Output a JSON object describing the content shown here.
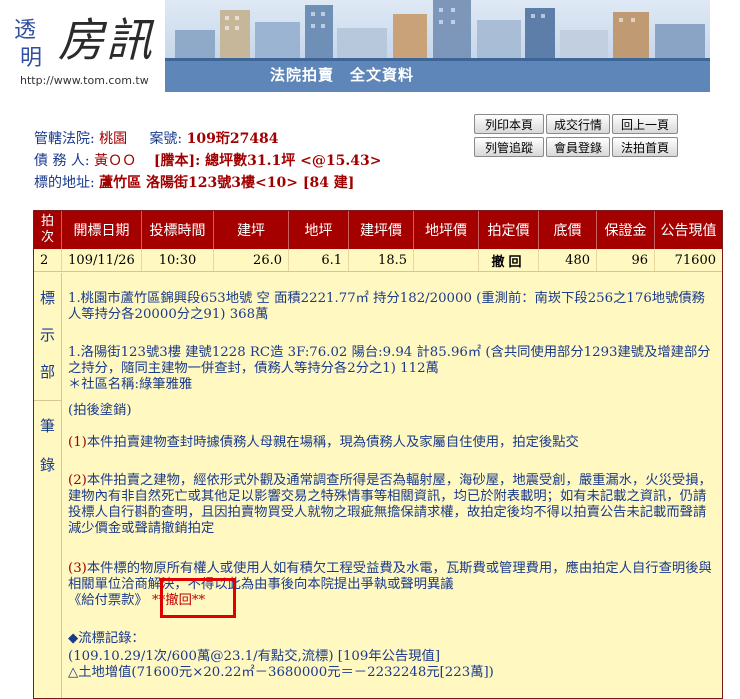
{
  "banner": {
    "logo_char1": "透",
    "logo_char2": "明",
    "logo_main": "房訊",
    "url": "http://www.tom.com.tw",
    "title": "法院拍賣　全文資料"
  },
  "info": {
    "court_label": "管轄法院:",
    "court_value": "桃園",
    "case_label": "案號:",
    "case_value": "109珩27484",
    "debtor_label": "債 務 人:",
    "debtor_value": "黃ＯＯ",
    "copy_label": "[謄本]: 總坪數31.1坪 <@15.43>",
    "address_label": "標的地址:",
    "address_value": "蘆竹區 洛陽街123號3樓<10> [84 建]"
  },
  "buttons": {
    "print": "列印本頁",
    "deal": "成交行情",
    "prev": "回上一頁",
    "track": "列管追蹤",
    "login": "會員登錄",
    "home": "法拍首頁"
  },
  "table": {
    "headers": [
      "拍\n次",
      "開標日期",
      "投標時間",
      "建坪",
      "地坪",
      "建坪價",
      "地坪價",
      "拍定價",
      "底價",
      "保證金",
      "公告現值"
    ],
    "row": {
      "seq": "2",
      "date": "109/11/26",
      "time": "10:30",
      "build_area": "26.0",
      "land_area": "6.1",
      "build_price": "18.5",
      "land_price": "",
      "result": "撤回",
      "base_price": "480",
      "deposit": "96",
      "announced": "71600"
    }
  },
  "mark_section": {
    "label": [
      "標",
      "示",
      "部"
    ],
    "line1": "1.桃園市蘆竹區錦興段653地號 空 面積2221.77㎡ 持分182/20000 (重測前：南崁下段256之176地號債務人等持分各20000分之91) 368萬",
    "line2": "1.洛陽街123號3樓 建號1228 RC造 3F:76.02 陽台:9.94 計85.96㎡ (含共同使用部分1293建號及增建部分之持分，隨同主建物一併查封，債務人等持分各2分之1) 112萬",
    "line3": "＊社區名稱:綠筆雅雅"
  },
  "note_section": {
    "label": [
      "筆",
      "錄"
    ],
    "line0": "(拍後塗銷)",
    "n1_prefix": "(1)",
    "n1_text": "本件拍賣建物查封時據債務人母親在場稱，現為債務人及家屬自住使用，拍定後點交",
    "n2_prefix": "(2)",
    "n2_text": "本件拍賣之建物，經依形式外觀及通常調查所得是否為輻射屋，海砂屋，地震受創，嚴重漏水，火災受損，建物內有非自然死亡或其他足以影響交易之特殊情事等相關資訊，均已於附表載明；如有未記載之資訊，仍請投標人自行斟酌查明，且因拍賣物買受人就物之瑕疵無擔保請求權，故拍定後均不得以拍賣公告未記載而聲請減少價金或聲請撤銷拍定",
    "n3_prefix": "(3)",
    "n3_text": "本件標的物原所有權人或使用人如有積欠工程受益費及水電，瓦斯費或管理費用，應由拍定人自行查明後與相關單位洽商解決，不得以此為由事後向本院提出爭執或聲明異議",
    "n4_text": "《給付票款》",
    "n4_revoked": "**撤回**",
    "n5": "◆流標記錄：",
    "n6": "(109.10.29/1次/600萬@23.1/有點交,流標) [109年公告現值]",
    "n7": "△土地增值(71600元×20.22㎡－3680000元＝－2232248元[223萬])"
  }
}
